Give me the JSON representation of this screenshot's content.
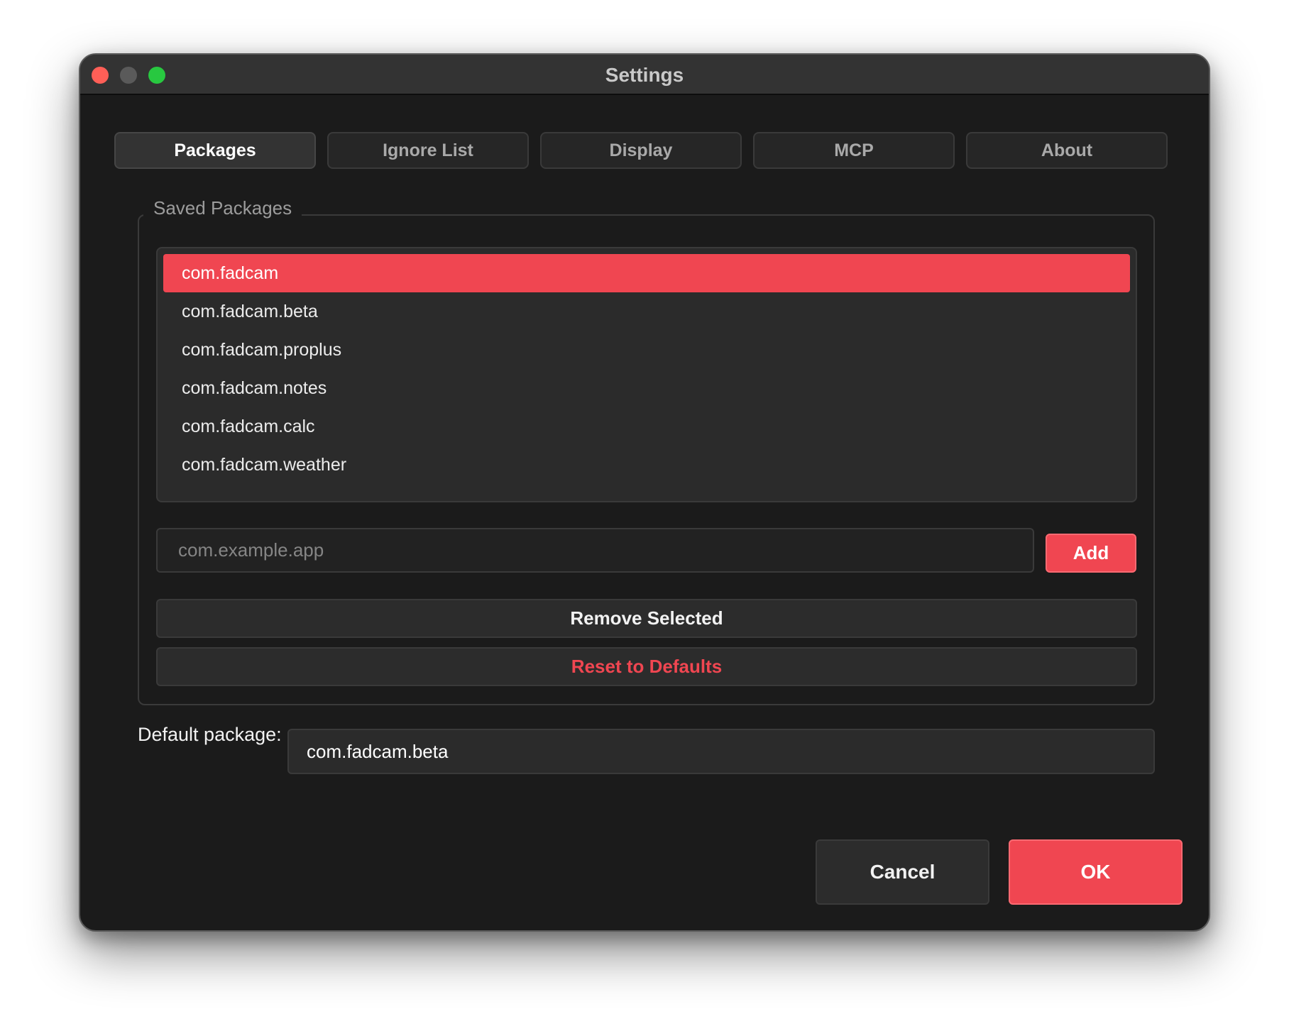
{
  "window": {
    "title": "Settings"
  },
  "tabs": [
    {
      "label": "Packages",
      "active": true
    },
    {
      "label": "Ignore List",
      "active": false
    },
    {
      "label": "Display",
      "active": false
    },
    {
      "label": "MCP",
      "active": false
    },
    {
      "label": "About",
      "active": false
    }
  ],
  "saved_packages": {
    "legend": "Saved Packages",
    "items": [
      {
        "label": "com.fadcam",
        "selected": true
      },
      {
        "label": "com.fadcam.beta",
        "selected": false
      },
      {
        "label": "com.fadcam.proplus",
        "selected": false
      },
      {
        "label": "com.fadcam.notes",
        "selected": false
      },
      {
        "label": "com.fadcam.calc",
        "selected": false
      },
      {
        "label": "com.fadcam.weather",
        "selected": false
      }
    ],
    "input_placeholder": "com.example.app",
    "add_label": "Add",
    "remove_label": "Remove Selected",
    "reset_label": "Reset to Defaults"
  },
  "default_package": {
    "label": "Default package:",
    "value": "com.fadcam.beta"
  },
  "footer": {
    "cancel_label": "Cancel",
    "ok_label": "OK"
  },
  "colors": {
    "accent": "#f04651",
    "background": "#1b1b1b",
    "titlebar": "#333333",
    "traffic_red": "#ff5f57",
    "traffic_green": "#28c840"
  }
}
